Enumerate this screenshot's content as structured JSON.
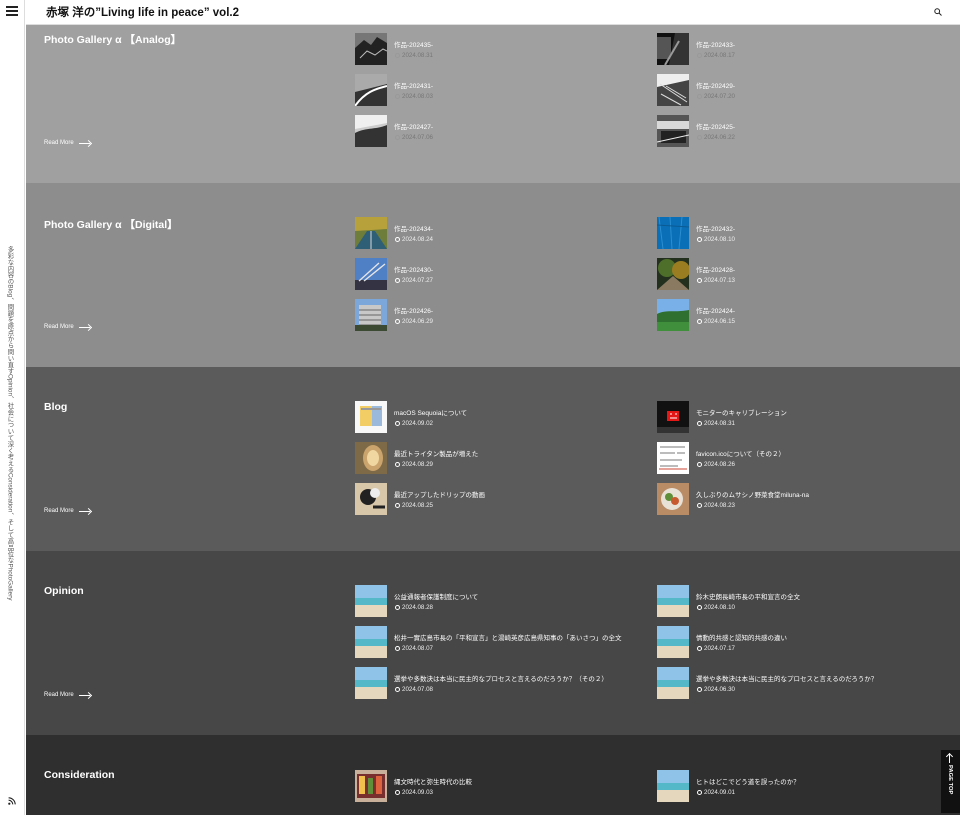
{
  "header": {
    "title": "赤塚 洋の”Living life in peace” vol.2"
  },
  "sidebar": {
    "description": "多彩な内容のBlog、問題を原点から問い直すOpinion、社会について深く考えるConsideration、そして高品位なPhotoGallery"
  },
  "read_more_label": "Read More",
  "page_top_label": "PAGE TOP",
  "sections": {
    "analog": {
      "title": "Photo Gallery α 【Analog】",
      "posts": [
        {
          "title": "作品-202435-",
          "date": "2024.08.31"
        },
        {
          "title": "作品-202433-",
          "date": "2024.08.17"
        },
        {
          "title": "作品-202431-",
          "date": "2024.08.03"
        },
        {
          "title": "作品-202429-",
          "date": "2024.07.20"
        },
        {
          "title": "作品-202427-",
          "date": "2024.07.06"
        },
        {
          "title": "作品-202425-",
          "date": "2024.06.22"
        }
      ]
    },
    "digital": {
      "title": "Photo Gallery α 【Digital】",
      "posts": [
        {
          "title": "作品-202434-",
          "date": "2024.08.24"
        },
        {
          "title": "作品-202432-",
          "date": "2024.08.10"
        },
        {
          "title": "作品-202430-",
          "date": "2024.07.27"
        },
        {
          "title": "作品-202428-",
          "date": "2024.07.13"
        },
        {
          "title": "作品-202426-",
          "date": "2024.06.29"
        },
        {
          "title": "作品-202424-",
          "date": "2024.06.15"
        }
      ]
    },
    "blog": {
      "title": "Blog",
      "posts": [
        {
          "title": "macOS Sequoiaについて",
          "date": "2024.09.02"
        },
        {
          "title": "モニターのキャリブレーション",
          "date": "2024.08.31"
        },
        {
          "title": "最近トライタン製品が増えた",
          "date": "2024.08.29"
        },
        {
          "title": "favicon.icoについて（その２）",
          "date": "2024.08.26"
        },
        {
          "title": "最近アップしたドリップの動画",
          "date": "2024.08.25"
        },
        {
          "title": "久しぶりのムサシノ野菜食堂miluna-na",
          "date": "2024.08.23"
        }
      ]
    },
    "opinion": {
      "title": "Opinion",
      "posts": [
        {
          "title": "公益通報者保護制度について",
          "date": "2024.08.28"
        },
        {
          "title": "鈴木史朗長崎市長の平和宣言の全文",
          "date": "2024.08.10"
        },
        {
          "title": "松井一實広島市長の「平和宣言」と湯崎英彦広島県知事の「あいさつ」の全文",
          "date": "2024.08.07"
        },
        {
          "title": "情動的共感と認知的共感の違い",
          "date": "2024.07.17"
        },
        {
          "title": "選挙や多数決は本当に民主的なプロセスと言えるのだろうか？（その２）",
          "date": "2024.07.08"
        },
        {
          "title": "選挙や多数決は本当に民主的なプロセスと言えるのだろうか？",
          "date": "2024.06.30"
        }
      ]
    },
    "consideration": {
      "title": "Consideration",
      "posts": [
        {
          "title": "縄文時代と弥生時代の比較",
          "date": "2024.09.03"
        },
        {
          "title": "ヒトはどこでどう道を誤ったのか？",
          "date": "2024.09.01"
        }
      ]
    }
  },
  "colors": {
    "analog": "#a0a0a0",
    "digital": "#8d8d8d",
    "blog": "#5b5b5b",
    "opinion": "#474747",
    "consideration": "#2f2f2f"
  }
}
